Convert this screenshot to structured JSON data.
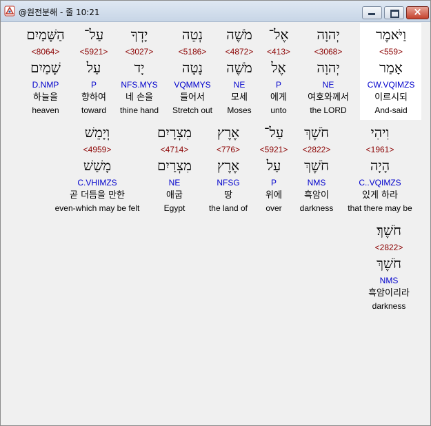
{
  "window": {
    "title": "@원전분해 - 줄 10:21"
  },
  "colors": {
    "strongs": "#8b0000",
    "morph": "#0000cc",
    "highlight": "#ffffff"
  },
  "rows": [
    {
      "words": [
        {
          "hebrew": "וַיֹּאמֶר",
          "strongs": "<559>",
          "lemma": "אָמַר",
          "morph": "CW.VQIMZS",
          "korean": "이르시되",
          "english": "And-said"
        },
        {
          "hebrew": "יְהוָה",
          "strongs": "<3068>",
          "lemma": "יְהוָה",
          "morph": "NE",
          "korean": "여호와께서",
          "english": "the LORD"
        },
        {
          "hebrew": "אֶל־",
          "strongs": "<413>",
          "lemma": "אֶל",
          "morph": "P",
          "korean": "에게",
          "english": "unto"
        },
        {
          "hebrew": "מֹשֶׁה",
          "strongs": "<4872>",
          "lemma": "מֹשֶׁה",
          "morph": "NE",
          "korean": "모세",
          "english": "Moses"
        },
        {
          "hebrew": "נְטֵה",
          "strongs": "<5186>",
          "lemma": "נָטָה",
          "morph": "VQMMYS",
          "korean": "들어서",
          "english": "Stretch out"
        },
        {
          "hebrew": "יָדְךָ",
          "strongs": "<3027>",
          "lemma": "יָד",
          "morph": "NFS.MYS",
          "korean": "네 손을",
          "english": "thine hand"
        },
        {
          "hebrew": "עַל־",
          "strongs": "<5921>",
          "lemma": "עַל",
          "morph": "P",
          "korean": "향하여",
          "english": "toward"
        },
        {
          "hebrew": "הַשָּׁמַיִם",
          "strongs": "<8064>",
          "lemma": "שָׁמַיִם",
          "morph": "D.NMP",
          "korean": "하늘을",
          "english": "heaven"
        }
      ]
    },
    {
      "words": [
        {
          "hebrew": "וִיהִי",
          "strongs": "<1961>",
          "lemma": "הָיָה",
          "morph": "C..VQIMZS",
          "korean": "있게 하라",
          "english": "that there may be"
        },
        {
          "hebrew": "חֹשֶׁךְ",
          "strongs": "<2822>",
          "lemma": "חֹשֶׁךְ",
          "morph": "NMS",
          "korean": "흑암이",
          "english": "darkness"
        },
        {
          "hebrew": "עַל־",
          "strongs": "<5921>",
          "lemma": "עַל",
          "morph": "P",
          "korean": "위에",
          "english": "over"
        },
        {
          "hebrew": "אֶרֶץ",
          "strongs": "<776>",
          "lemma": "אֶרֶץ",
          "morph": "NFSG",
          "korean": "땅",
          "english": "the land of"
        },
        {
          "hebrew": "מִצְרָיִם",
          "strongs": "<4714>",
          "lemma": "מִצְרַיִם",
          "morph": "NE",
          "korean": "애굽",
          "english": "Egypt"
        },
        {
          "hebrew": "וְיָמֵשׁ",
          "strongs": "<4959>",
          "lemma": "מָשַׁשׁ",
          "morph": "C.VHIMZS",
          "korean": "곧 더듬을 만한",
          "english": "even-which may be felt"
        }
      ]
    },
    {
      "words": [
        {
          "hebrew": "חֹשֶׁךְ׃",
          "strongs": "<2822>",
          "lemma": "חֹשֶׁךְ",
          "morph": "NMS",
          "korean": "흑암이리라",
          "english": "darkness"
        }
      ]
    }
  ]
}
